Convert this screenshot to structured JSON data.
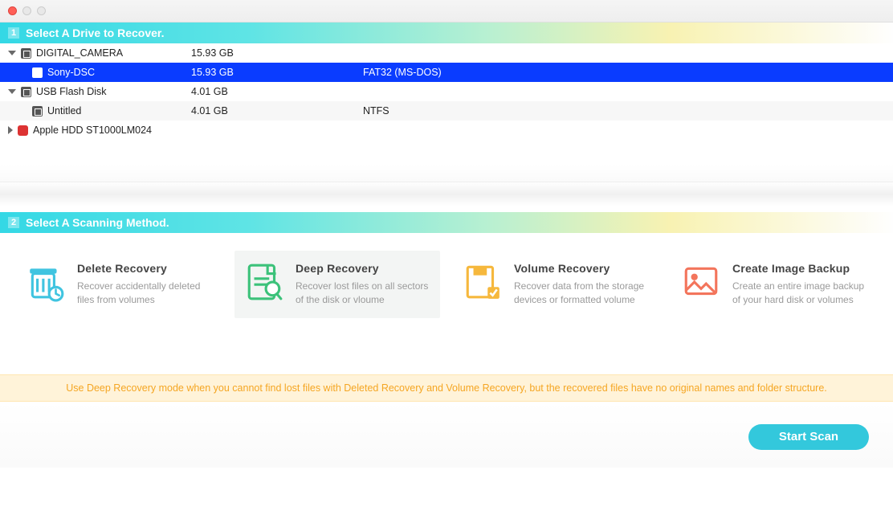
{
  "window": null,
  "section1": {
    "step": "1",
    "title": "Select A Drive to Recover."
  },
  "drives": [
    {
      "kind": "parent",
      "expanded": true,
      "name": "DIGITAL_CAMERA",
      "size": "15.93 GB",
      "fs": "",
      "iconType": "usb",
      "selected": false
    },
    {
      "kind": "child",
      "name": "Sony-DSC",
      "size": "15.93 GB",
      "fs": "FAT32 (MS-DOS)",
      "iconType": "usb",
      "selected": true
    },
    {
      "kind": "parent",
      "expanded": true,
      "name": "USB Flash Disk",
      "size": "4.01 GB",
      "fs": "",
      "iconType": "usb",
      "selected": false
    },
    {
      "kind": "child",
      "name": "Untitled",
      "size": "4.01 GB",
      "fs": "NTFS",
      "iconType": "usb",
      "selected": false,
      "alt": true
    },
    {
      "kind": "parent",
      "expanded": false,
      "name": "Apple HDD ST1000LM024",
      "size": "",
      "fs": "",
      "iconType": "hdd",
      "selected": false
    }
  ],
  "section2": {
    "step": "2",
    "title": "Select A Scanning Method."
  },
  "methods": [
    {
      "id": "delete",
      "title": "Delete Recovery",
      "desc": "Recover accidentally deleted files from volumes",
      "selected": false,
      "color": "#40c4e0"
    },
    {
      "id": "deep",
      "title": "Deep Recovery",
      "desc": "Recover lost files on all sectors of the disk or vloume",
      "selected": true,
      "color": "#3cc27a"
    },
    {
      "id": "volume",
      "title": "Volume Recovery",
      "desc": "Recover data from the storage devices or formatted volume",
      "selected": false,
      "color": "#f6b83d"
    },
    {
      "id": "image",
      "title": "Create Image Backup",
      "desc": "Create an entire image backup of your hard disk or volumes",
      "selected": false,
      "color": "#f3755c"
    }
  ],
  "hint": "Use Deep Recovery mode when you cannot find lost files with Deleted Recovery and Volume Recovery, but the recovered files have no original names and folder structure.",
  "startButton": "Start Scan"
}
